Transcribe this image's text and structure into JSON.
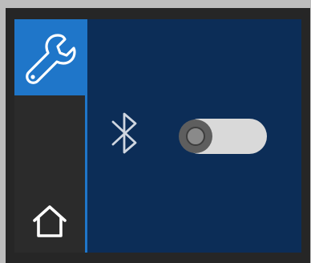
{
  "sidebar": {
    "tabs": [
      {
        "icon": "wrench-icon",
        "selected": true
      },
      {
        "icon": "home-icon",
        "selected": false
      }
    ]
  },
  "bluetooth": {
    "icon": "bluetooth-icon",
    "toggle_on": false
  },
  "colors": {
    "device_frame": "#262626",
    "screen_background": "#0c2d57",
    "accent": "#1f76c9",
    "sidebar_background": "#2b2b2b",
    "toggle_track": "#d9d9d9",
    "toggle_knob": "#5e5e5e"
  }
}
